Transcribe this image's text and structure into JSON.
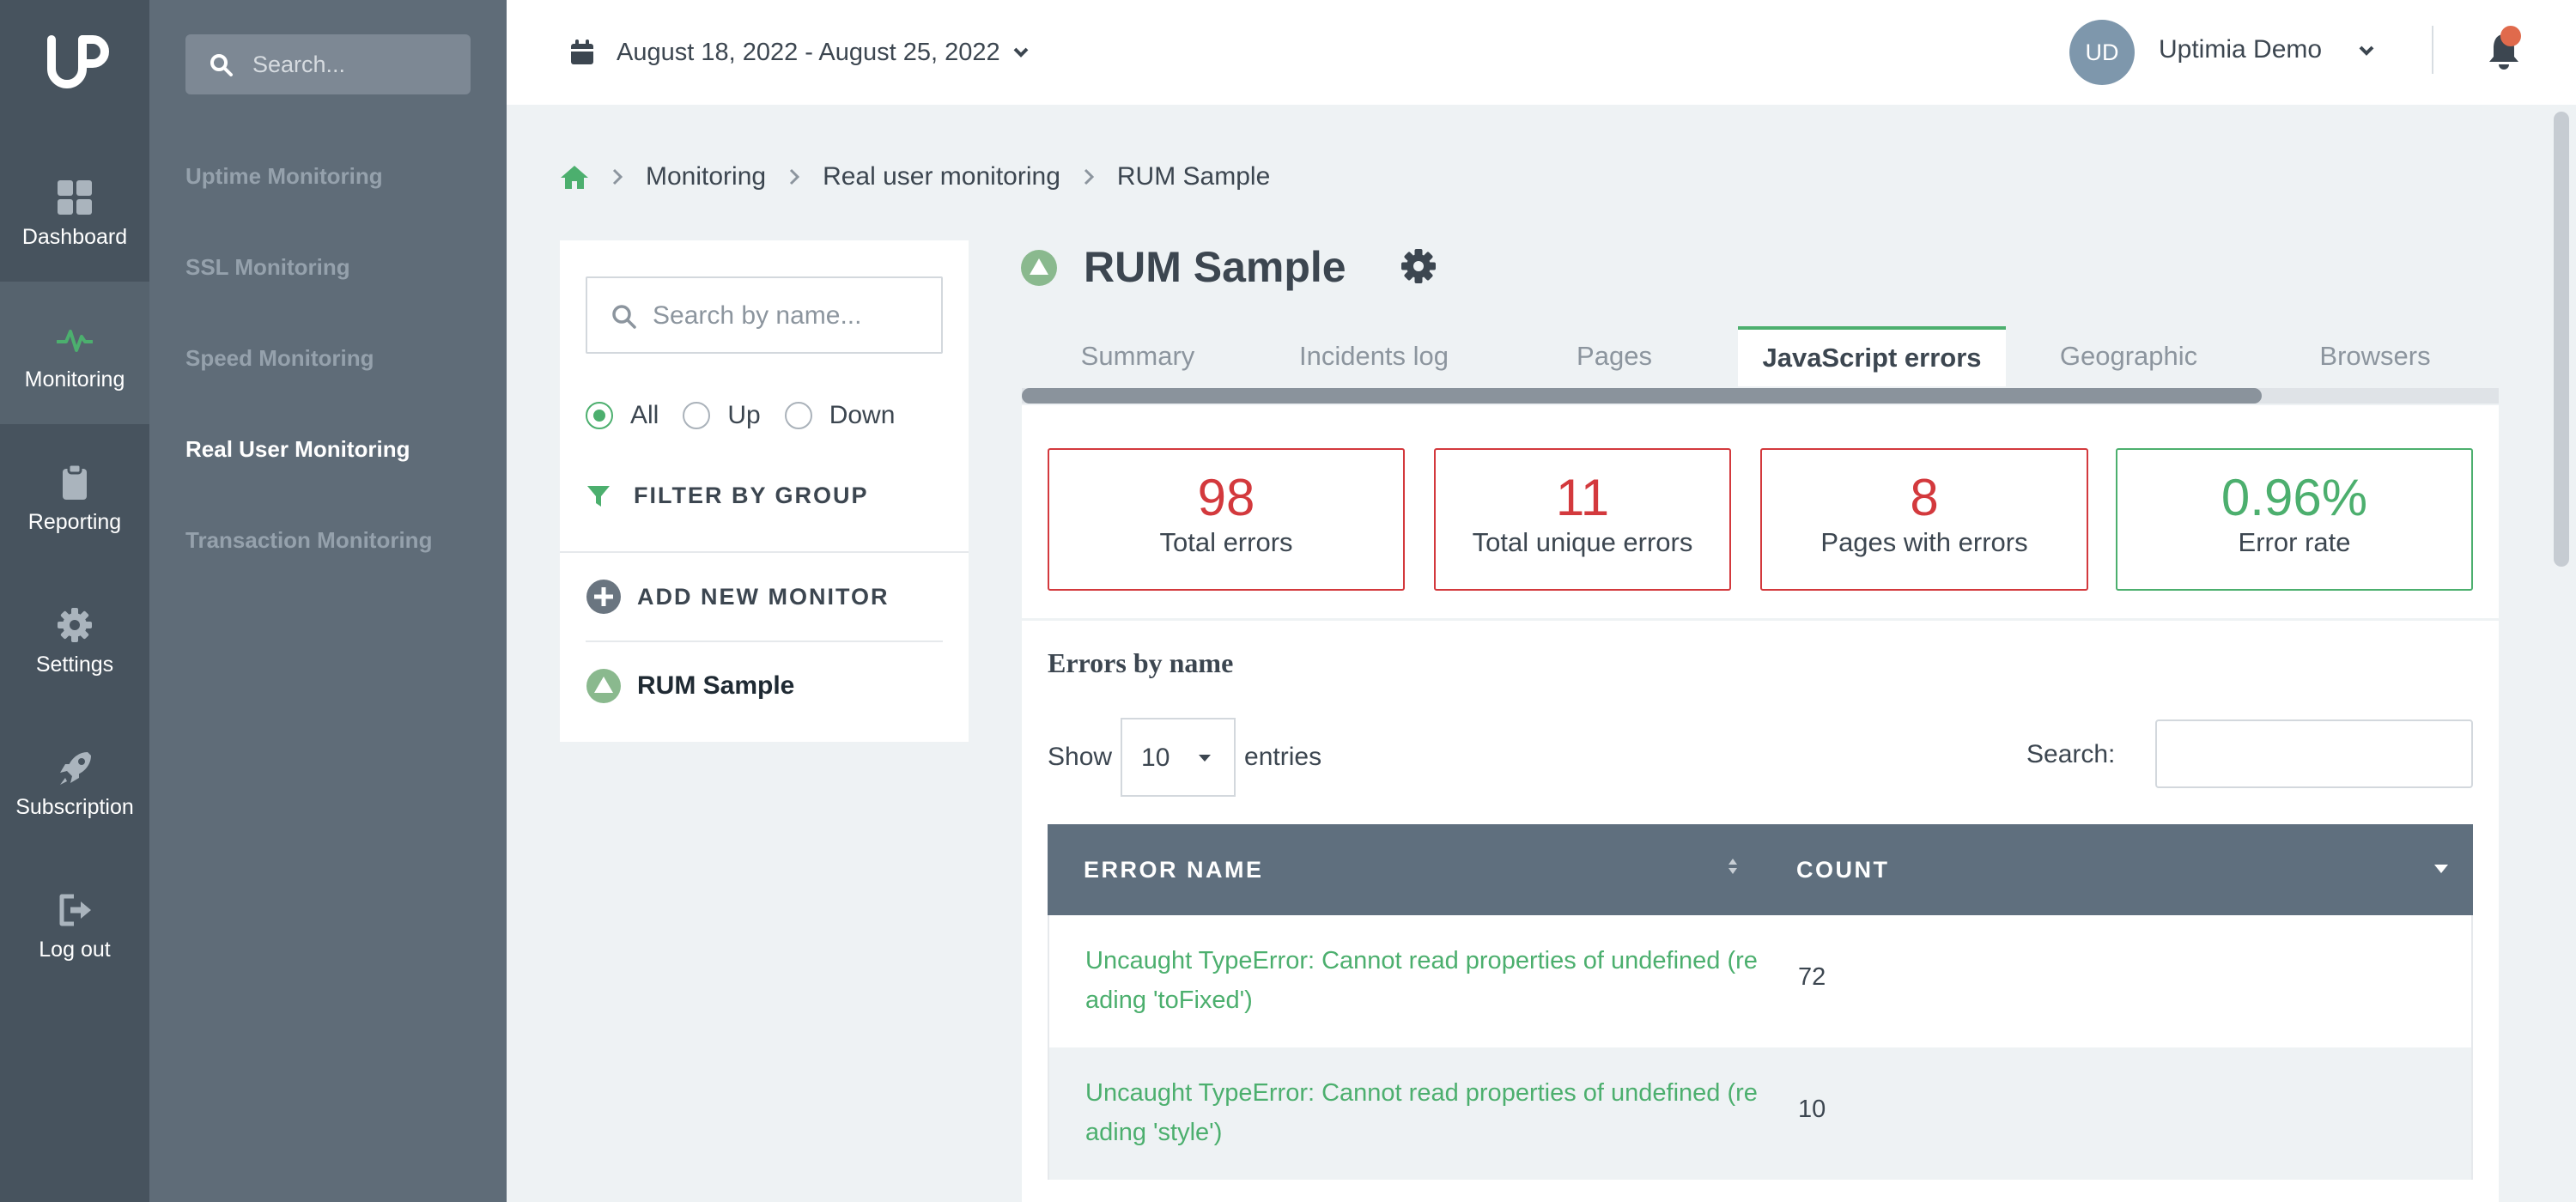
{
  "brand": {
    "logo": "UP"
  },
  "rail": {
    "items": [
      {
        "label": "Dashboard",
        "icon": "dashboard-icon"
      },
      {
        "label": "Monitoring",
        "icon": "pulse-icon"
      },
      {
        "label": "Reporting",
        "icon": "clipboard-icon"
      },
      {
        "label": "Settings",
        "icon": "gear-icon"
      },
      {
        "label": "Subscription",
        "icon": "rocket-icon"
      },
      {
        "label": "Log out",
        "icon": "logout-icon"
      }
    ],
    "active": "Monitoring"
  },
  "subnav": {
    "search_placeholder": "Search...",
    "items": [
      {
        "label": "Uptime Monitoring"
      },
      {
        "label": "SSL Monitoring"
      },
      {
        "label": "Speed Monitoring"
      },
      {
        "label": "Real User Monitoring"
      },
      {
        "label": "Transaction Monitoring"
      }
    ],
    "active": "Real User Monitoring"
  },
  "header": {
    "date_range": "August 18, 2022 - August 25, 2022",
    "user_initials": "UD",
    "user_name": "Uptimia Demo"
  },
  "breadcrumb": {
    "items": [
      "Monitoring",
      "Real user monitoring"
    ],
    "current": "RUM Sample"
  },
  "monitors": {
    "search_placeholder": "Search by name...",
    "filters": [
      "All",
      "Up",
      "Down"
    ],
    "selected_filter": "All",
    "filter_by_group": "FILTER BY GROUP",
    "add_new": "ADD NEW MONITOR",
    "list": [
      {
        "name": "RUM Sample",
        "status": "up"
      }
    ]
  },
  "main": {
    "title": "RUM Sample",
    "tabs": [
      {
        "label": "Summary"
      },
      {
        "label": "Incidents log"
      },
      {
        "label": "Pages"
      },
      {
        "label": "JavaScript errors"
      },
      {
        "label": "Geographic"
      },
      {
        "label": "Browsers"
      }
    ],
    "active_tab": "JavaScript errors",
    "stats": [
      {
        "value": "98",
        "label": "Total errors",
        "status": "error"
      },
      {
        "value": "11",
        "label": "Total unique errors",
        "status": "error"
      },
      {
        "value": "8",
        "label": "Pages with errors",
        "status": "error"
      },
      {
        "value": "0.96%",
        "label": "Error rate",
        "status": "ok"
      }
    ],
    "section_title": "Errors by name",
    "show_label": "Show",
    "entries_value": "10",
    "entries_label": "entries",
    "search_label": "Search:",
    "table": {
      "columns": [
        "ERROR NAME",
        "COUNT"
      ],
      "rows": [
        {
          "name": "Uncaught TypeError: Cannot read properties of undefined (reading 'toFixed')",
          "count": "72"
        },
        {
          "name": "Uncaught TypeError: Cannot read properties of undefined (reading 'style')",
          "count": "10"
        }
      ]
    }
  },
  "colors": {
    "accent_green": "#4caf6e",
    "error_red": "#d3393d",
    "rail_bg": "#47535e",
    "subnav_bg": "#5f6c78",
    "table_header": "#5f6f7e",
    "notification_dot": "#e06a4c"
  }
}
